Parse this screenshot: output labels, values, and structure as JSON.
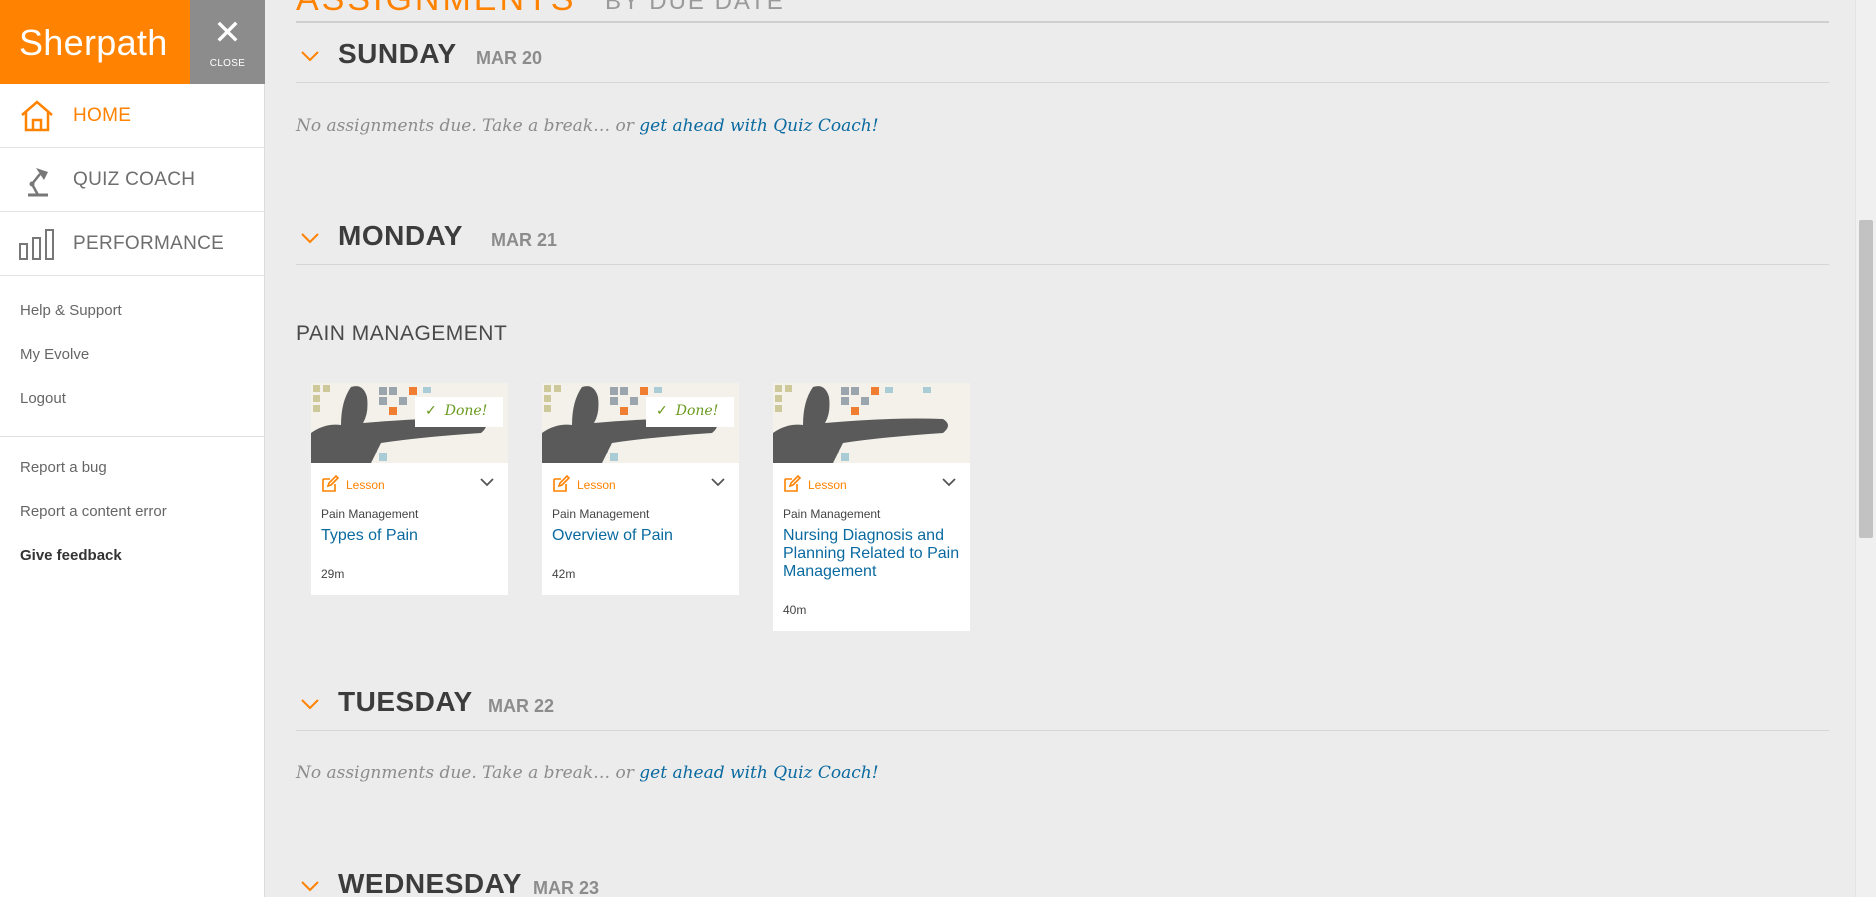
{
  "brand": {
    "name": "Sherpath",
    "close_label": "CLOSE"
  },
  "nav": {
    "items": [
      {
        "label": "HOME"
      },
      {
        "label": "QUIZ COACH"
      },
      {
        "label": "PERFORMANCE"
      }
    ],
    "links": [
      "Help & Support",
      "My Evolve",
      "Logout"
    ],
    "feedback_links": [
      "Report a bug",
      "Report a content error",
      "Give feedback"
    ]
  },
  "header": {
    "title": "ASSIGNMENTS",
    "subtitle": "BY DUE DATE"
  },
  "days": [
    {
      "name": "SUNDAY",
      "date": "MAR 20"
    },
    {
      "name": "MONDAY",
      "date": "MAR 21"
    },
    {
      "name": "TUESDAY",
      "date": "MAR 22"
    },
    {
      "name": "WEDNESDAY",
      "date": "MAR 23"
    }
  ],
  "empty_state": {
    "text": "No assignments due. Take a break… or ",
    "link": "get ahead with Quiz Coach!"
  },
  "group": {
    "title": "PAIN MANAGEMENT"
  },
  "cards": [
    {
      "type": "Lesson",
      "course": "Pain Management",
      "title": "Types of Pain",
      "duration": "29m",
      "status": "Done!"
    },
    {
      "type": "Lesson",
      "course": "Pain Management",
      "title": "Overview of Pain",
      "duration": "42m",
      "status": "Done!"
    },
    {
      "type": "Lesson",
      "course": "Pain Management",
      "title": "Nursing Diagnosis and Planning Related to Pain Management",
      "duration": "40m",
      "status": ""
    }
  ],
  "colors": {
    "brand": "#ff8200",
    "link": "#0a6aa0",
    "done": "#6a9a1f"
  }
}
